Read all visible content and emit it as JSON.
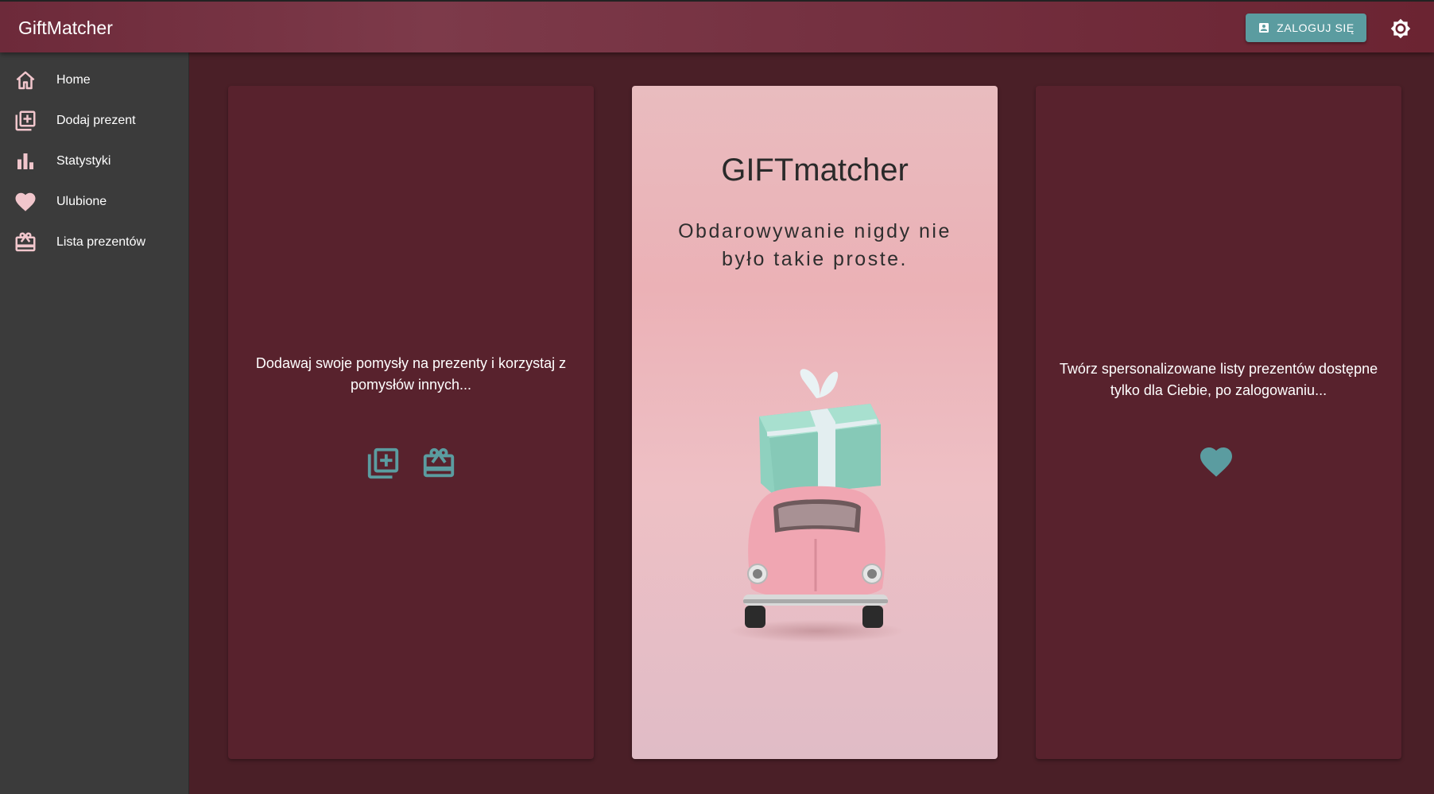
{
  "app": {
    "title": "GiftMatcher"
  },
  "header": {
    "login_label": "ZALOGUJ SIĘ",
    "login_icon": "account-box-icon",
    "theme_icon": "brightness-icon"
  },
  "sidebar": {
    "items": [
      {
        "label": "Home",
        "icon": "home-icon"
      },
      {
        "label": "Dodaj prezent",
        "icon": "add-box-icon"
      },
      {
        "label": "Statystyki",
        "icon": "bar-chart-icon"
      },
      {
        "label": "Ulubione",
        "icon": "heart-icon"
      },
      {
        "label": "Lista prezentów",
        "icon": "gift-card-icon"
      }
    ]
  },
  "cards": {
    "left": {
      "text": "Dodawaj swoje pomysły na prezenty i korzystaj z pomysłów innych...",
      "icons": [
        "add-box-icon",
        "gift-card-icon"
      ]
    },
    "center": {
      "title": "GIFTmatcher",
      "subtitle": "Obdarowywanie nigdy nie było takie proste."
    },
    "right": {
      "text": "Twórz spersonalizowane listy prezentów dostępne tylko dla Ciebie, po zalogowaniu...",
      "icons": [
        "heart-icon"
      ]
    }
  },
  "colors": {
    "appbar": "#743040",
    "background": "#4a1f27",
    "card": "#58222d",
    "sidebar": "#3b3b3b",
    "accent_teal": "#5b9ca0",
    "nav_icon_pink": "#f1c6cc"
  }
}
